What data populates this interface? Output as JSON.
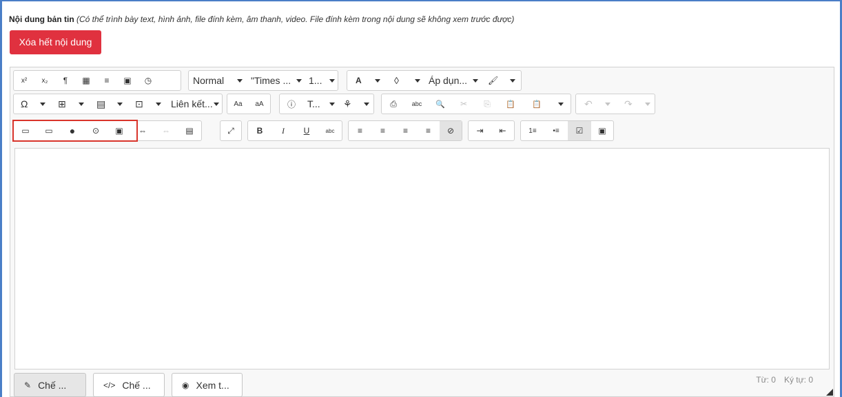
{
  "header": {
    "label_bold": "Nội dung bản tin",
    "label_note": "(Có thể trình bày text, hình ảnh, file đính kèm, âm thanh, video. File đính kèm trong nội dung sẽ không xem trước được)",
    "clear_button": "Xóa hết nội dung"
  },
  "toolbar": {
    "row1": {
      "superscript": "x²",
      "subscript": "x₂",
      "paragraph": "¶",
      "format_block": "▦",
      "align_block": "≡",
      "date_icon": "▣",
      "time_icon": "◷",
      "format_select": "Normal",
      "font_select": "\"Times ...",
      "size_select": "1...",
      "text_color": "A",
      "bg_color": "◊",
      "apply_style": "Áp dụn...",
      "format_painter": "🖌"
    },
    "row2": {
      "special_char": "Ω",
      "table": "⊞",
      "table_cells": "▤",
      "template": "⊡",
      "link_select": "Liên kết...",
      "lowercase": "Aa",
      "uppercase": "aA",
      "info": "ⓘ",
      "text_select": "T...",
      "tree": "⚘",
      "print": "⎙",
      "spellcheck": "abc",
      "find": "🔍",
      "cut": "✂",
      "copy": "⎘",
      "paste": "📋",
      "paste_special": "📋",
      "undo": "↶",
      "redo": "↷"
    },
    "row3": {
      "image": "▭",
      "image_gallery": "▭",
      "video": "●",
      "media": "⊙",
      "audio": "▣",
      "link": "⇔",
      "unlink": "⇔",
      "anchor": "▤",
      "fullscreen": "⤢",
      "bold": "B",
      "italic": "I",
      "underline": "U",
      "strikethrough": "abc",
      "align_left": "≡",
      "align_center": "≡",
      "align_right": "≡",
      "align_justify": "≡",
      "clear_format": "⊘",
      "indent": "⇥",
      "outdent": "⇤",
      "ordered_list": "1≡",
      "bullet_list": "•≡",
      "checklist": "☑",
      "preview": "▣"
    }
  },
  "footer": {
    "mode_design": "Chế ...",
    "mode_code": "Chế ...",
    "mode_preview": "Xem t...",
    "word_count": "Từ: 0",
    "char_count": "Ký tự: 0"
  },
  "colors": {
    "accent": "#4a7ec7",
    "danger": "#e0313f",
    "highlight_box": "#d9342b"
  }
}
